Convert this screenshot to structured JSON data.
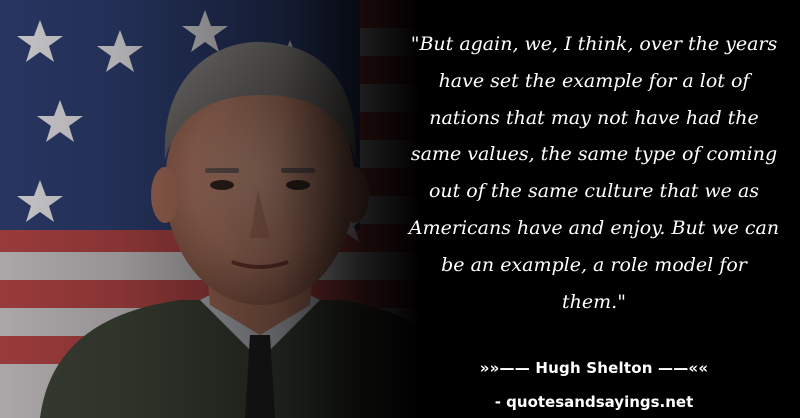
{
  "quote": {
    "text": "\"But again, we, I think, over the years have set the example for a lot of nations that may not have had the same values, the same type of coming out of the same culture that we as Americans have and enjoy. But we can be an example, a role model for them.\""
  },
  "attribution": {
    "author_line": "»»—— Hugh Shelton ——««",
    "site_line": "- quotesandsayings.net"
  },
  "colors": {
    "background": "#000000",
    "text": "#ffffff",
    "flag_red": "#b03a3a",
    "flag_blue": "#2a3c6e"
  }
}
